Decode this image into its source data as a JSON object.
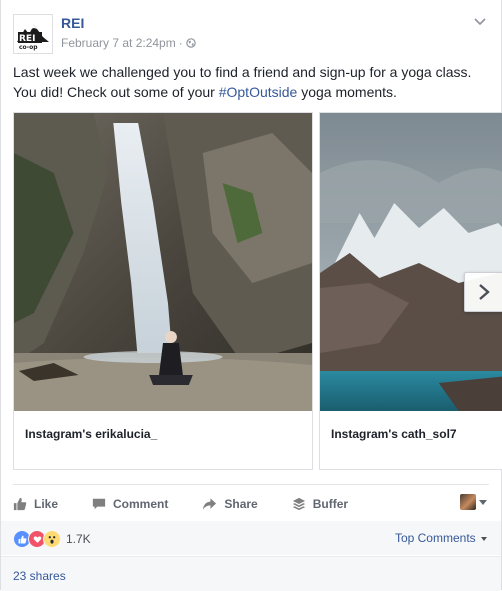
{
  "header": {
    "page_name": "REI",
    "timestamp": "February 7 at 2:24pm",
    "separator": "·",
    "logo_text": "REI",
    "logo_subtext": "co-op"
  },
  "post": {
    "text_before": "Last week we challenged you to find a friend and sign-up for a yoga class. You did! Check out some of your ",
    "hashtag": "#OptOutside",
    "text_after": " yoga moments."
  },
  "carousel": {
    "cards": [
      {
        "caption": "Instagram's erikalucia_"
      },
      {
        "caption": "Instagram's cath_sol7"
      }
    ]
  },
  "actions": {
    "like": "Like",
    "comment": "Comment",
    "share": "Share",
    "buffer": "Buffer"
  },
  "reactions": {
    "count": "1.7K",
    "top_comments": "Top Comments"
  },
  "shares": {
    "label": "23 shares"
  },
  "colors": {
    "link_blue": "#365899",
    "like_blue": "#5890ff",
    "love_red": "#f25268",
    "wow_yellow": "#ffd972"
  }
}
